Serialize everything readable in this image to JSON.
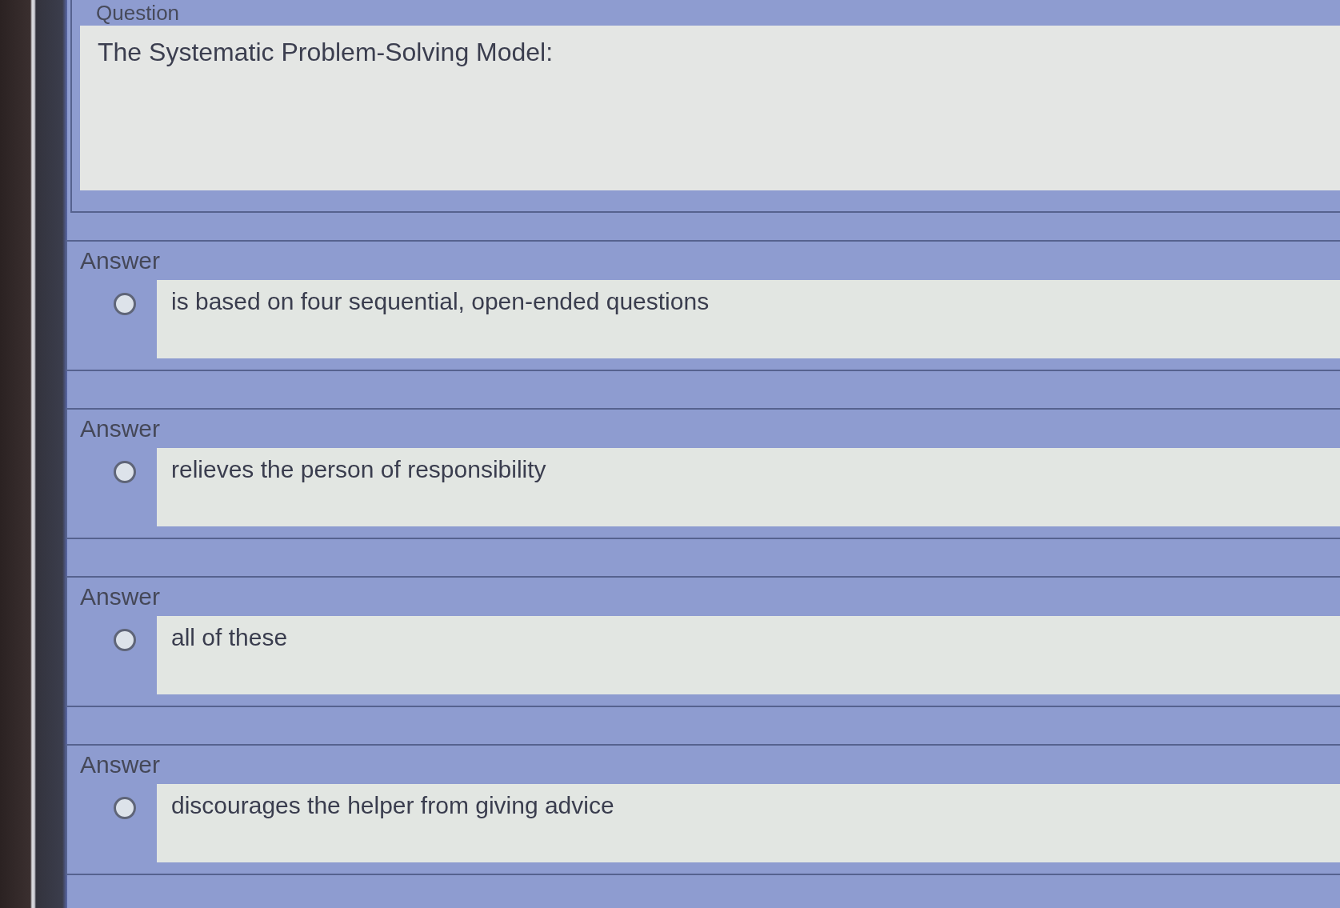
{
  "question": {
    "label": "Question",
    "text": "The Systematic Problem-Solving Model:"
  },
  "answers": [
    {
      "label": "Answer",
      "text": "is based on four sequential, open-ended questions",
      "selected": false
    },
    {
      "label": "Answer",
      "text": "relieves the person of responsibility",
      "selected": false
    },
    {
      "label": "Answer",
      "text": "all of these",
      "selected": false
    },
    {
      "label": "Answer",
      "text": "discourages the helper from giving advice",
      "selected": false
    }
  ]
}
